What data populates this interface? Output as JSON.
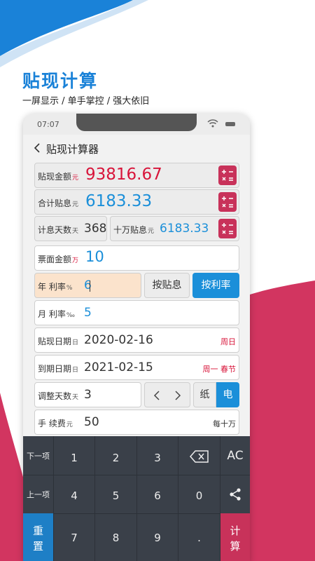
{
  "promo": {
    "headline": "贴现计算",
    "subline": "一屏显示 / 单手掌控 / 强大依旧"
  },
  "status_bar": {
    "time": "07:07"
  },
  "nav": {
    "title": "贴现计算器"
  },
  "results": {
    "discount_amount": {
      "label": "贴现金额",
      "unit": "元",
      "value": "93816.67"
    },
    "total_interest": {
      "label": "合计贴息",
      "unit": "元",
      "value": "6183.33"
    },
    "interest_days": {
      "label": "计息天数",
      "unit": "天",
      "value": "368"
    },
    "per_100k_interest": {
      "label": "十万贴息",
      "unit": "元",
      "value": "6183.33"
    }
  },
  "inputs": {
    "face_amount": {
      "label": "票面金额",
      "unit": "万",
      "value": "10"
    },
    "annual_rate": {
      "label": "年 利率",
      "unit": "%",
      "value": "6"
    },
    "by_interest_button": "按贴息",
    "by_rate_button": "按利率",
    "monthly_rate": {
      "label": "月 利率",
      "unit": "‰",
      "value": "5"
    },
    "discount_date": {
      "label": "贴现日期",
      "unit": "日",
      "value": "2020-02-16",
      "note": "周日"
    },
    "maturity_date": {
      "label": "到期日期",
      "unit": "日",
      "value": "2021-02-15",
      "note": "周一 春节"
    },
    "adjust_days": {
      "label": "调整天数",
      "unit": "天",
      "value": "3"
    },
    "paper_option": "纸",
    "electronic_option": "电",
    "fee": {
      "label": "手 续费",
      "unit": "元",
      "value": "50",
      "note": "每十万"
    }
  },
  "keypad": {
    "next": "下一项",
    "prev": "上一项",
    "reset_1": "重",
    "reset_2": "置",
    "calc_1": "计",
    "calc_2": "算",
    "ac": "AC",
    "digits": [
      "1",
      "2",
      "3",
      "4",
      "5",
      "6",
      "7",
      "8",
      "9",
      "0",
      "."
    ]
  },
  "colors": {
    "accent_blue": "#1b8fd9",
    "accent_red": "#c8325a",
    "value_red": "#d8143a",
    "keypad_bg": "#3a4049"
  }
}
